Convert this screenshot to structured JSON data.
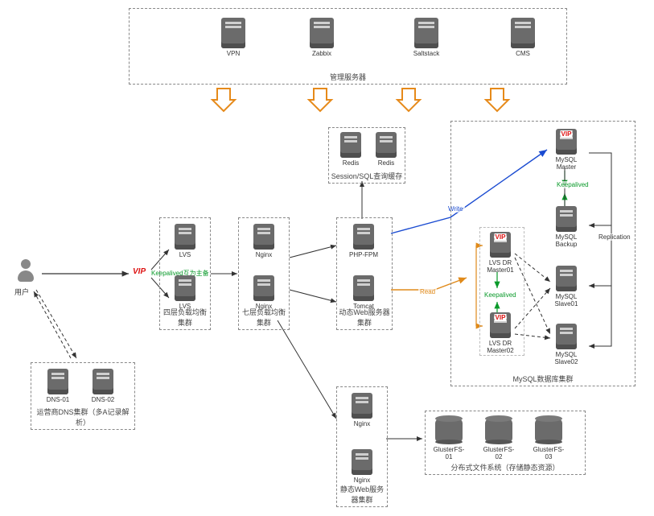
{
  "user": {
    "label": "用户"
  },
  "mgmt": {
    "group_label": "管理服务器",
    "items": [
      {
        "id": "vpn",
        "label": "VPN"
      },
      {
        "id": "zabbix",
        "label": "Zabbix"
      },
      {
        "id": "saltstack",
        "label": "Saltstack"
      },
      {
        "id": "cms",
        "label": "CMS"
      }
    ]
  },
  "dns": {
    "group_label": "运营商DNS集群（多A记录解析）",
    "items": [
      {
        "id": "dns01",
        "label": "DNS-01"
      },
      {
        "id": "dns02",
        "label": "DNS-02"
      }
    ]
  },
  "l4": {
    "group_label": "四层负载均衡集群",
    "vip": "VIP",
    "vip_note": "Keepalived互为主备",
    "items": [
      {
        "id": "lvs1",
        "label": "LVS"
      },
      {
        "id": "lvs2",
        "label": "LVS"
      }
    ]
  },
  "l7": {
    "group_label": "七层负载均衡集群",
    "items": [
      {
        "id": "ng1",
        "label": "Nginx"
      },
      {
        "id": "ng2",
        "label": "Nginx"
      }
    ]
  },
  "cache": {
    "group_label": "Session/SQL查询缓存",
    "items": [
      {
        "id": "redis1",
        "label": "Redis"
      },
      {
        "id": "redis2",
        "label": "Redis"
      }
    ]
  },
  "dynweb": {
    "group_label": "动态Web服务器集群",
    "items": [
      {
        "id": "php",
        "label": "PHP-FPM"
      },
      {
        "id": "tomcat",
        "label": "Tomcat"
      }
    ]
  },
  "staticweb": {
    "group_label": "静态Web服务器集群",
    "items": [
      {
        "id": "sng1",
        "label": "Nginx"
      },
      {
        "id": "sng2",
        "label": "Nginx"
      }
    ]
  },
  "mysql": {
    "group_label": "MySQL数据库集群",
    "vip_lvs1": "VIP",
    "vip_lvs2": "VIP",
    "vip_master": "VIP",
    "keepalived": "Keepalived",
    "items": {
      "lvs_dr1": "LVS DR Master01",
      "lvs_dr2": "LVS DR Master02",
      "master": "MySQL Master",
      "backup": "MySQL Backup",
      "slave01": "MySQL Slave01",
      "slave02": "MySQL Slave02"
    }
  },
  "dfs": {
    "group_label": "分布式文件系统（存储静态资源）",
    "items": [
      {
        "id": "gfs1",
        "label": "GlusterFS-01"
      },
      {
        "id": "gfs2",
        "label": "GlusterFS-02"
      },
      {
        "id": "gfs3",
        "label": "GlusterFS-03"
      }
    ]
  },
  "labels": {
    "write": "Write",
    "read": "Read",
    "replication": "Replication",
    "keepalived": "Keepalived"
  }
}
